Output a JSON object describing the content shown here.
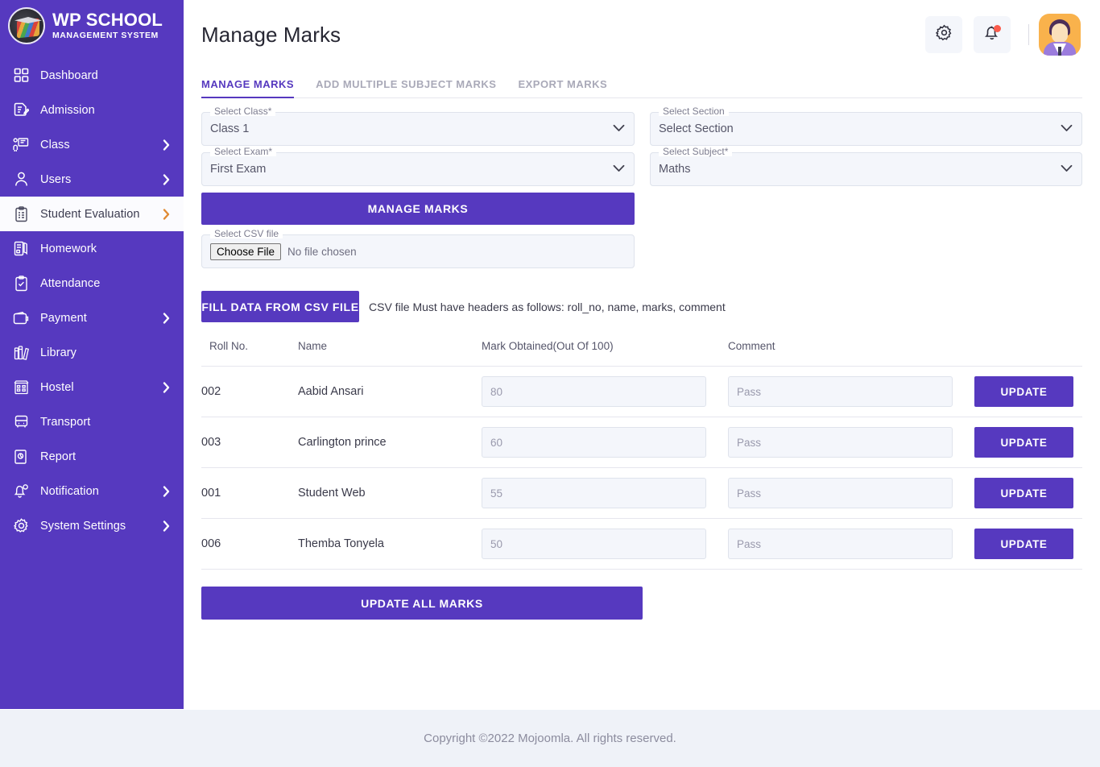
{
  "brand": {
    "title": "WP SCHOOL",
    "subtitle": "MANAGEMENT SYSTEM",
    "logo_icon": "school-logo-icon",
    "sidebar_color": "#5639bf"
  },
  "sidebar": {
    "items": [
      {
        "label": "Dashboard",
        "icon": "grid-icon",
        "has_chevron": false,
        "active": false
      },
      {
        "label": "Admission",
        "icon": "form-edit-icon",
        "has_chevron": false,
        "active": false
      },
      {
        "label": "Class",
        "icon": "classroom-icon",
        "has_chevron": true,
        "active": false
      },
      {
        "label": "Users",
        "icon": "user-icon",
        "has_chevron": true,
        "active": false
      },
      {
        "label": "Student Evaluation",
        "icon": "clipboard-list-icon",
        "has_chevron": true,
        "active": true
      },
      {
        "label": "Homework",
        "icon": "book-icon",
        "has_chevron": false,
        "active": false
      },
      {
        "label": "Attendance",
        "icon": "clipboard-check-icon",
        "has_chevron": false,
        "active": false
      },
      {
        "label": "Payment",
        "icon": "wallet-icon",
        "has_chevron": true,
        "active": false
      },
      {
        "label": "Library",
        "icon": "library-books-icon",
        "has_chevron": false,
        "active": false
      },
      {
        "label": "Hostel",
        "icon": "building-icon",
        "has_chevron": true,
        "active": false
      },
      {
        "label": "Transport",
        "icon": "bus-icon",
        "has_chevron": false,
        "active": false
      },
      {
        "label": "Report",
        "icon": "report-document-icon",
        "has_chevron": false,
        "active": false
      },
      {
        "label": "Notification",
        "icon": "bell-pin-icon",
        "has_chevron": true,
        "active": false
      },
      {
        "label": "System Settings",
        "icon": "gear-icon",
        "has_chevron": true,
        "active": false
      }
    ]
  },
  "header": {
    "title": "Manage Marks",
    "settings_icon": "gear-icon",
    "notification_icon": "bell-icon",
    "notification_dot_color": "#fb5c4d",
    "avatar_icon": "user-avatar"
  },
  "tabs": [
    {
      "label": "MANAGE MARKS",
      "active": true
    },
    {
      "label": "ADD MULTIPLE SUBJECT MARKS",
      "active": false
    },
    {
      "label": "EXPORT MARKS",
      "active": false
    }
  ],
  "form": {
    "select_class": {
      "legend": "Select Class*",
      "value": "Class 1",
      "options": [
        "Class 1"
      ]
    },
    "select_section": {
      "legend": "Select Section",
      "value": "Select Section",
      "options": [
        "Select Section"
      ]
    },
    "select_exam": {
      "legend": "Select Exam*",
      "value": "First Exam",
      "options": [
        "First Exam"
      ]
    },
    "select_subject": {
      "legend": "Select Subject*",
      "value": "Maths",
      "options": [
        "Maths"
      ]
    },
    "manage_marks_button": "MANAGE MARKS",
    "csv_file": {
      "legend": "Select CSV file",
      "choose_button": "Choose File",
      "status": "No file chosen"
    },
    "fill_csv_button": "FILL DATA FROM CSV FILE",
    "csv_hint": "CSV file Must have headers as follows: roll_no, name, marks, comment"
  },
  "table": {
    "columns": [
      "Roll No.",
      "Name",
      "Mark Obtained(Out Of 100)",
      "Comment",
      ""
    ],
    "rows": [
      {
        "roll_no": "002",
        "name": "Aabid Ansari",
        "mark": "80",
        "comment": "Pass",
        "action": "UPDATE"
      },
      {
        "roll_no": "003",
        "name": "Carlington prince",
        "mark": "60",
        "comment": "Pass",
        "action": "UPDATE"
      },
      {
        "roll_no": "001",
        "name": "Student Web",
        "mark": "55",
        "comment": "Pass",
        "action": "UPDATE"
      },
      {
        "roll_no": "006",
        "name": "Themba Tonyela",
        "mark": "50",
        "comment": "Pass",
        "action": "UPDATE"
      }
    ]
  },
  "update_all_button": "UPDATE ALL MARKS",
  "footer": {
    "text": "Copyright ©2022 Mojoomla. All rights reserved."
  }
}
